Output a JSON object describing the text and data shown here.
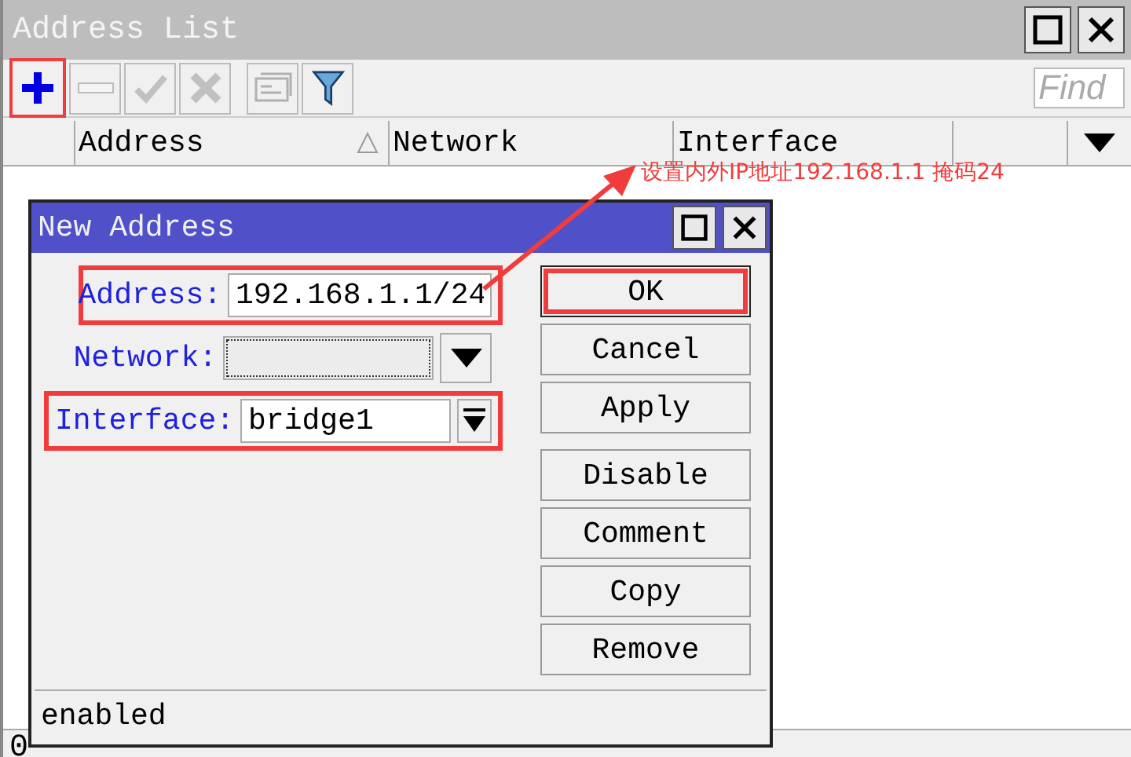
{
  "window": {
    "title": "Address List"
  },
  "toolbar": [
    {
      "kind": "add",
      "disabled": false,
      "highlighted": true
    },
    {
      "kind": "remove",
      "disabled": true,
      "highlighted": false
    },
    {
      "kind": "enable",
      "disabled": true,
      "highlighted": false
    },
    {
      "kind": "disable",
      "disabled": true,
      "highlighted": false
    },
    {
      "kind": "comment",
      "disabled": true,
      "highlighted": false
    },
    {
      "kind": "filter",
      "disabled": false,
      "highlighted": false
    }
  ],
  "search": {
    "placeholder": "Find"
  },
  "table": {
    "columns": [
      {
        "label": "Address",
        "sorted": true
      },
      {
        "label": "Network",
        "sorted": false
      },
      {
        "label": "Interface",
        "sorted": false
      }
    ]
  },
  "status_bar": "0",
  "annotation": {
    "text": "设置内外IP地址192.168.1.1 掩码24"
  },
  "dialog": {
    "title": "New Address",
    "fields": [
      {
        "kind": "text",
        "label": "Address:",
        "value": "192.168.1.1/24",
        "focused": false,
        "highlighted": true
      },
      {
        "kind": "dropdown",
        "label": "Network:",
        "focused": true,
        "highlighted": false
      },
      {
        "kind": "combo",
        "label": "Interface:",
        "value": "bridge1",
        "focused": false,
        "highlighted": true
      }
    ],
    "buttons": [
      {
        "label": "OK",
        "default": true,
        "highlighted": true
      },
      {
        "label": "Cancel",
        "default": false,
        "highlighted": false
      },
      {
        "label": "Apply",
        "default": false,
        "highlighted": false
      }
    ],
    "more_buttons": [
      {
        "label": "Disable"
      },
      {
        "label": "Comment"
      },
      {
        "label": "Copy"
      },
      {
        "label": "Remove"
      }
    ],
    "status": "enabled"
  }
}
